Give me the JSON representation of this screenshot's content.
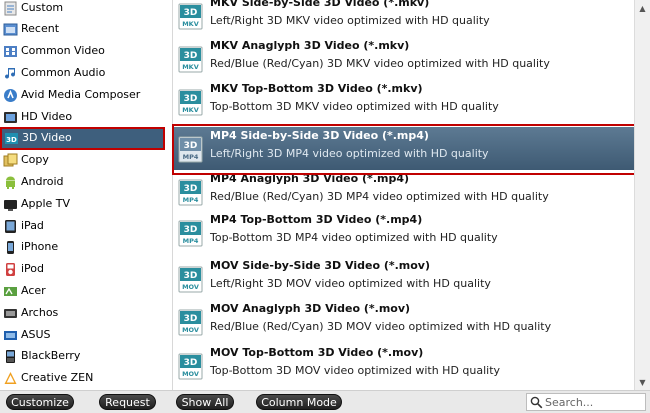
{
  "sidebar": {
    "items": [
      {
        "label": "Custom",
        "icon": "custom-icon"
      },
      {
        "label": "Recent",
        "icon": "recent-icon"
      },
      {
        "label": "Common Video",
        "icon": "film-icon"
      },
      {
        "label": "Common Audio",
        "icon": "music-note-icon"
      },
      {
        "label": "Avid Media Composer",
        "icon": "avid-icon"
      },
      {
        "label": "HD Video",
        "icon": "hd-icon"
      },
      {
        "label": "3D Video",
        "icon": "3d-icon",
        "selected": true
      },
      {
        "label": "Copy",
        "icon": "copy-icon"
      },
      {
        "label": "Android",
        "icon": "android-icon"
      },
      {
        "label": "Apple TV",
        "icon": "apple-tv-icon"
      },
      {
        "label": "iPad",
        "icon": "ipad-icon"
      },
      {
        "label": "iPhone",
        "icon": "iphone-icon"
      },
      {
        "label": "iPod",
        "icon": "ipod-icon"
      },
      {
        "label": "Acer",
        "icon": "acer-icon"
      },
      {
        "label": "Archos",
        "icon": "archos-icon"
      },
      {
        "label": "ASUS",
        "icon": "asus-icon"
      },
      {
        "label": "BlackBerry",
        "icon": "blackberry-icon"
      },
      {
        "label": "Creative ZEN",
        "icon": "creative-zen-icon"
      }
    ]
  },
  "formats": [
    {
      "title": "MKV Side-by-Side 3D Video (*.mkv)",
      "desc": "Left/Right 3D MKV video optimized with HD quality",
      "badge": "MKV"
    },
    {
      "title": "MKV Anaglyph 3D Video (*.mkv)",
      "desc": "Red/Blue (Red/Cyan) 3D MKV video optimized with HD quality",
      "badge": "MKV"
    },
    {
      "title": "MKV Top-Bottom 3D Video (*.mkv)",
      "desc": "Top-Bottom 3D MKV video optimized with HD quality",
      "badge": "MKV"
    },
    {
      "title": "MP4 Side-by-Side 3D Video (*.mp4)",
      "desc": "Left/Right 3D MP4 video optimized with HD quality",
      "badge": "MP4",
      "selected": true
    },
    {
      "title": "MP4 Anaglyph 3D Video (*.mp4)",
      "desc": "Red/Blue (Red/Cyan) 3D MP4 video optimized with HD quality",
      "badge": "MP4"
    },
    {
      "title": "MP4 Top-Bottom 3D Video (*.mp4)",
      "desc": "Top-Bottom 3D MP4 video optimized with HD quality",
      "badge": "MP4"
    },
    {
      "title": "MOV Side-by-Side 3D Video (*.mov)",
      "desc": "Left/Right 3D MOV video optimized with HD quality",
      "badge": "MOV"
    },
    {
      "title": "MOV Anaglyph 3D Video (*.mov)",
      "desc": "Red/Blue (Red/Cyan) 3D MOV video optimized with HD quality",
      "badge": "MOV"
    },
    {
      "title": "MOV Top-Bottom 3D Video (*.mov)",
      "desc": "Top-Bottom 3D MOV video optimized with HD quality",
      "badge": "MOV"
    }
  ],
  "toolbar": {
    "customize_label": "Customize",
    "request_label": "Request",
    "show_all_label": "Show All",
    "column_mode_label": "Column Mode",
    "search_placeholder": "Search..."
  },
  "colors": {
    "selection": "#3e5f7d",
    "highlight_outline": "#c00000",
    "badge_teal": "#2a8e9e"
  }
}
